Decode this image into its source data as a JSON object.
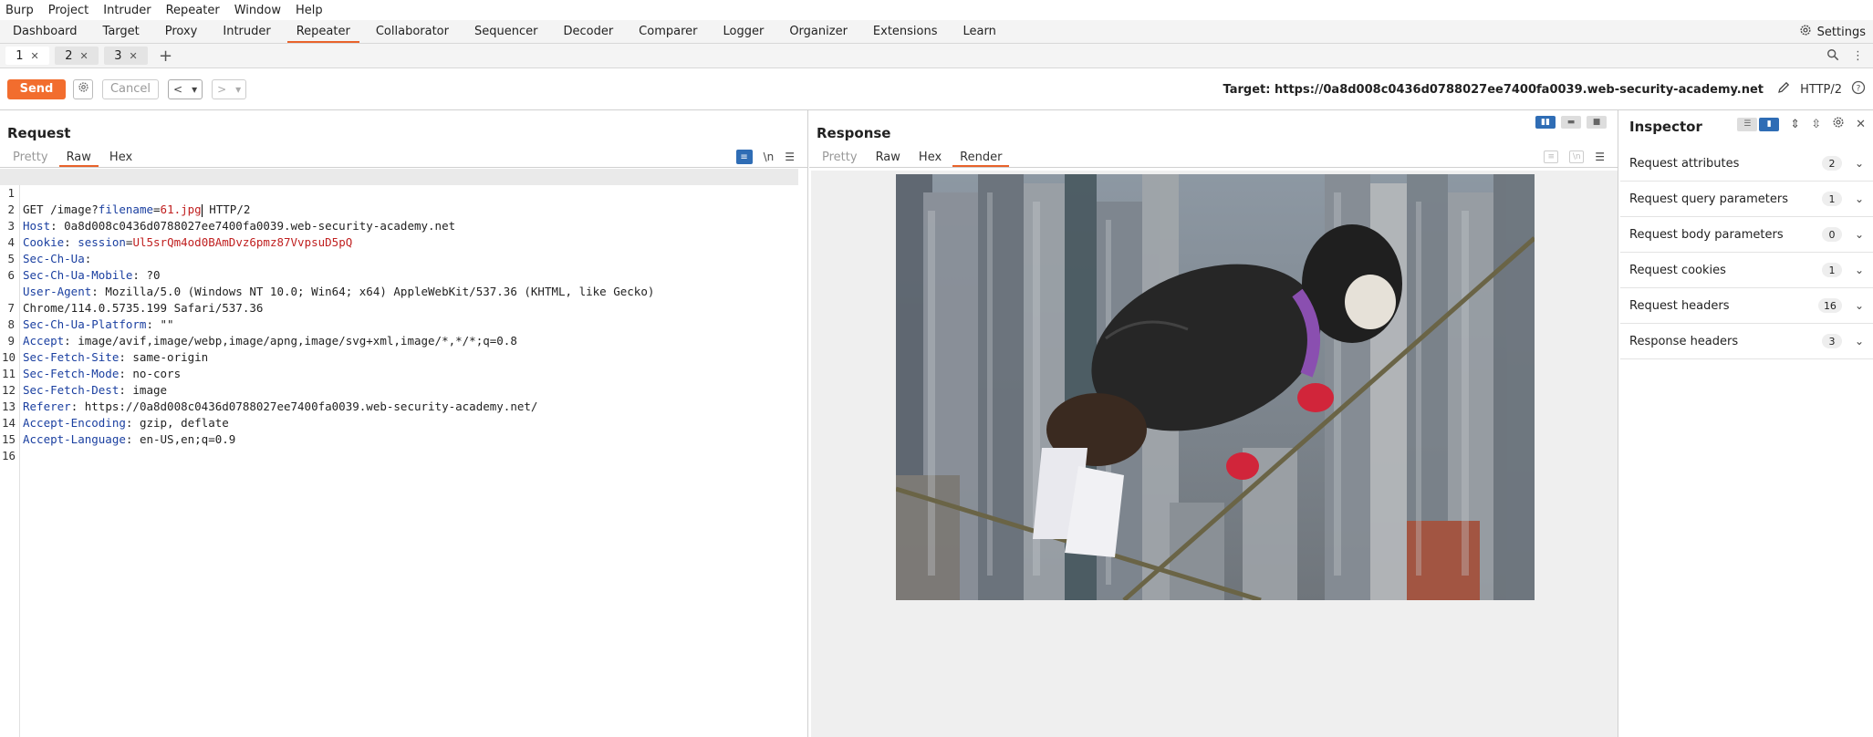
{
  "menu": [
    "Burp",
    "Project",
    "Intruder",
    "Repeater",
    "Window",
    "Help"
  ],
  "main_tabs": [
    "Dashboard",
    "Target",
    "Proxy",
    "Intruder",
    "Repeater",
    "Collaborator",
    "Sequencer",
    "Decoder",
    "Comparer",
    "Logger",
    "Organizer",
    "Extensions",
    "Learn"
  ],
  "active_main_tab": "Repeater",
  "settings_label": "Settings",
  "repeater_tabs": [
    "1",
    "2",
    "3"
  ],
  "toolbar": {
    "send_label": "Send",
    "cancel_label": "Cancel",
    "target_label": "Target: https://0a8d008c0436d0788027ee7400fa0039.web-security-academy.net",
    "http_version": "HTTP/2"
  },
  "request": {
    "title": "Request",
    "tabs": [
      "Pretty",
      "Raw",
      "Hex"
    ],
    "active_tab": "Raw",
    "newline_toggle": "\\n",
    "lines": [
      {
        "num": "1",
        "plain_before": "GET /image?",
        "param_key": "filename",
        "param_eq": "=",
        "param_val": "61.jpg",
        "plain_after": " HTTP/2"
      },
      {
        "num": "2",
        "key": "Host",
        "value": ": 0a8d008c0436d0788027ee7400fa0039.web-security-academy.net"
      },
      {
        "num": "3",
        "key": "Cookie",
        "value": ": ",
        "cookie_name": "session",
        "cookie_eq": "=",
        "cookie_val": "Ul5srQm4od0BAmDvz6pmz87VvpsuD5pQ"
      },
      {
        "num": "4",
        "key": "Sec-Ch-Ua",
        "value": ":"
      },
      {
        "num": "5",
        "key": "Sec-Ch-Ua-Mobile",
        "value": ": ?0"
      },
      {
        "num": "6",
        "key": "User-Agent",
        "value": ": Mozilla/5.0 (Windows NT 10.0; Win64; x64) AppleWebKit/537.36 (KHTML, like Gecko)"
      },
      {
        "num": "",
        "key": "",
        "value": "Chrome/114.0.5735.199 Safari/537.36"
      },
      {
        "num": "7",
        "key": "Sec-Ch-Ua-Platform",
        "value": ": \"\""
      },
      {
        "num": "8",
        "key": "Accept",
        "value": ": image/avif,image/webp,image/apng,image/svg+xml,image/*,*/*;q=0.8"
      },
      {
        "num": "9",
        "key": "Sec-Fetch-Site",
        "value": ": same-origin"
      },
      {
        "num": "10",
        "key": "Sec-Fetch-Mode",
        "value": ": no-cors"
      },
      {
        "num": "11",
        "key": "Sec-Fetch-Dest",
        "value": ": image"
      },
      {
        "num": "12",
        "key": "Referer",
        "value": ": https://0a8d008c0436d0788027ee7400fa0039.web-security-academy.net/"
      },
      {
        "num": "13",
        "key": "Accept-Encoding",
        "value": ": gzip, deflate"
      },
      {
        "num": "14",
        "key": "Accept-Language",
        "value": ": en-US,en;q=0.9"
      },
      {
        "num": "15",
        "key": "",
        "value": ""
      },
      {
        "num": "16",
        "key": "",
        "value": ""
      }
    ]
  },
  "response": {
    "title": "Response",
    "tabs": [
      "Pretty",
      "Raw",
      "Hex",
      "Render"
    ],
    "active_tab": "Render"
  },
  "inspector": {
    "title": "Inspector",
    "rows": [
      {
        "label": "Request attributes",
        "count": "2"
      },
      {
        "label": "Request query parameters",
        "count": "1"
      },
      {
        "label": "Request body parameters",
        "count": "0"
      },
      {
        "label": "Request cookies",
        "count": "1"
      },
      {
        "label": "Request headers",
        "count": "16"
      },
      {
        "label": "Response headers",
        "count": "3"
      }
    ]
  },
  "colors": {
    "accent": "#e8632b",
    "send": "#f26d2e",
    "selected_blue": "#2f6db5",
    "header_key": "#1a3fa0",
    "param_value": "#c02020"
  }
}
